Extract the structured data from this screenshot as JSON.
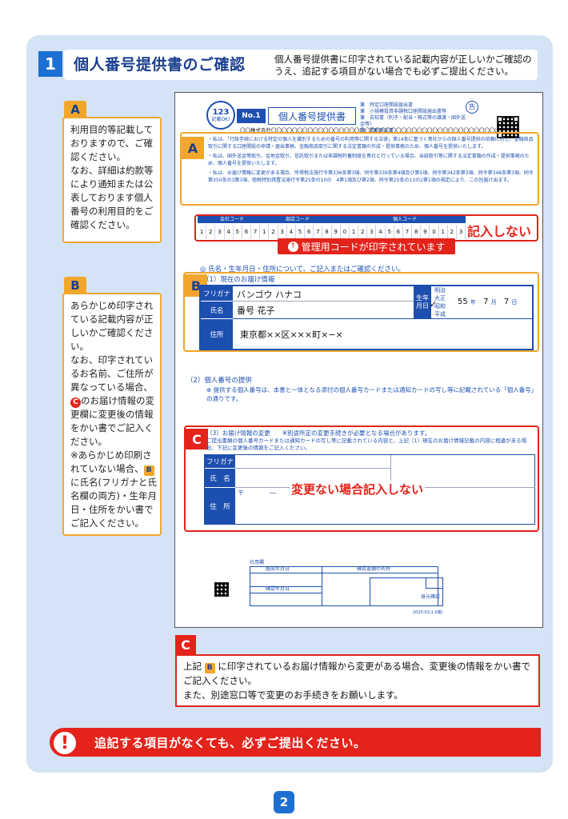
{
  "header": {
    "step_number": "1",
    "title": "個人番号提供書のご確認",
    "note": "個人番号提供書に印字されている記載内容が正しいかご確認のうえ、追記する項目がない場合でも必ずご提出ください。"
  },
  "side_a": {
    "tab": "A",
    "text": "利用目的等記載しておりますので、ご確認ください。\nなお、詳細は約款等により通知または公表しております個人番号の利用目的をご確認ください。"
  },
  "side_b": {
    "tab": "B",
    "text_1": "あらかじめ印字されている記載内容が正しいかご確認ください。\nなお、印字されているお名前、ご住所が異なっている場合、",
    "icon_c": "C",
    "text_2": "のお届け情報の変更欄に変更後の情報をかい書でご記入ください。",
    "text_3": "※あらかじめ印刷されていない場合、",
    "icon_b": "B",
    "text_4": "に氏名(フリガナと氏名欄の両方)・生年月日・住所をかい書でご記入ください。"
  },
  "document": {
    "logo_number": "123",
    "logo_text": "記載OK!",
    "no_label": "No.1",
    "title": "個人番号提供書",
    "kind_lines": [
      "兼　特定口座開設届出書",
      "兼　小規模投資非課税口座開設届出書等",
      "兼　告知書（利子・配当・株式等の譲渡・国外送金等）",
      "兼　異動届出書"
    ],
    "kind_stamp": "告",
    "addressee": "〇〇株式会社〇〇〇〇〇〇〇〇〇〇〇〇〇〇〇〇〇〇〇〇〇〇〇〇〇〇〇〇〇〇〇〇〇〇〇〇〇〇〇〇〇〇〇〇〇〇〇〇〇〇〇〇〇〇〇〇〇〇〇〇 御中",
    "section_a_tab": "A",
    "purpose_paragraphs": [
      "・私は、「行政手続における特定の個人を識別するための番号の利用等に関する法律」第14条に基づく貴社からの個人番号提供の依頼に対し、金融商品取引に関する口座開設の申請・届出事務、金融商品取引に関する法定書類の作成・提供事務のため、個人番号を提供いたします。",
      "・私は、国外送金等取引、金地金取引、信託取引または非課税貯蓄制度を貴社と行っている場合、当該取引等に関する法定書類の作成・提供事務のため、個人番号を提供いたします。",
      "・私は、お届け情報に変更がある場合、所得税法施行令第336条第3項、同令第339条第4項及び第5項、同令第342条第3項、同令第348条第3項、同令第350条の3第3項、租税特別措置法施行令第25条の10の　4第1項及び第2項、同令第25条の13の2第1項の規定により、この旨届け出ます。"
    ],
    "code_headers": {
      "company": "会社コード",
      "branch": "部店コード",
      "personal": "個人コード"
    },
    "code_digits": [
      "1",
      "2",
      "3",
      "4",
      "5",
      "6",
      "7",
      "1",
      "2",
      "3",
      "4",
      "5",
      "6",
      "7",
      "8",
      "9",
      "0",
      "1",
      "2",
      "3",
      "4",
      "5",
      "6",
      "7",
      "8",
      "9",
      "0",
      "1",
      "2",
      "3"
    ],
    "no_write_label": "記入しない",
    "mgmt_note_icon": "↑",
    "mgmt_note": "管理用コードが印字されています",
    "intro": "◎ 氏名・生年月日・住所について、ご記入またはご確認ください。",
    "section_b_tab": "B",
    "sec1_title": "（1）現在のお届け情報",
    "label_furigana": "フリガナ",
    "value_furigana": "バンゴウ ハナコ",
    "label_name": "氏名",
    "value_name": "番号 花子",
    "label_birth": "生年月日",
    "eras": [
      "明治",
      "大正",
      "昭和",
      "平成"
    ],
    "era_check": "✓",
    "birth_year": "55",
    "unit_year": "年",
    "birth_month": "7",
    "unit_month": "月",
    "birth_day": "7",
    "unit_day": "日",
    "label_address": "住所",
    "value_address": "東京都××区×××町×−×",
    "sec2_title": "（2）個人番号の提供",
    "sec2_text": "⊕ 提供する個人番号は、本書と一体となる添付の個人番号カードまたは通知カードの写し等に記載されている「個人番号」の通りです。",
    "section_c_tab": "C",
    "sec3_title": "（3）お届け情報の変更　　※別途所定の変更手続きが必要となる場合があります。",
    "sec3_text": "ご提出書類の個人番号カードまたは通知カードの写し等に記載されている内容と、上記（1）現在のお届け情報記載の内容に相違がある場合、下記に変更後の情報をご記入ください。",
    "c_label_furigana": "フリガナ",
    "c_label_name": "氏　名",
    "c_label_address": "住　所",
    "c_postal": "〒　　　　―",
    "no_change_label": "変更ない場合記入しない",
    "office_label": "社用欄",
    "office_cols": [
      "届出年月日",
      "確認書類の名称"
    ],
    "office_row2": "確認年月日",
    "office_stamp": "身元確認",
    "footer_code": "2020.01(1.0版)"
  },
  "bottom_c": {
    "tab": "C",
    "text_1": "上記",
    "icon_b": "B",
    "text_2": "に印字されているお届け情報から変更がある場合、変更後の情報をかい書でご記入ください。\nまた、別途窓口等で変更のお手続きをお願いします。"
  },
  "banner": {
    "icon": "!",
    "text": "追記する項目がなくても、必ずご提出ください。"
  },
  "page_number": "2",
  "colors": {
    "panel": "#d4e3f6",
    "blue": "#1d6fd1",
    "navy": "#1a3f8f",
    "orange": "#f2a62b",
    "red": "#e4231b"
  }
}
